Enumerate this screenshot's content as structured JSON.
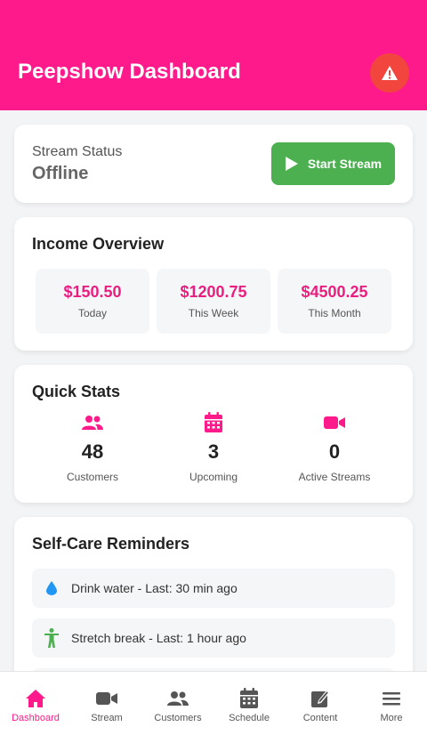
{
  "header": {
    "title": "Peepshow Dashboard",
    "alert_icon": "warning-icon"
  },
  "stream_status": {
    "label": "Stream Status",
    "value": "Offline",
    "button_label": "Start Stream"
  },
  "income": {
    "title": "Income Overview",
    "items": [
      {
        "value": "$150.50",
        "label": "Today"
      },
      {
        "value": "$1200.75",
        "label": "This Week"
      },
      {
        "value": "$4500.25",
        "label": "This Month"
      }
    ]
  },
  "quick_stats": {
    "title": "Quick Stats",
    "items": [
      {
        "icon": "users-icon",
        "value": "48",
        "label": "Customers"
      },
      {
        "icon": "calendar-icon",
        "value": "3",
        "label": "Upcoming"
      },
      {
        "icon": "video-icon",
        "value": "0",
        "label": "Active Streams"
      }
    ]
  },
  "self_care": {
    "title": "Self-Care Reminders",
    "items": [
      {
        "icon": "water-drop-icon",
        "text": "Drink water - Last: 30 min ago"
      },
      {
        "icon": "stretch-icon",
        "text": "Stretch break - Last: 1 hour ago"
      }
    ]
  },
  "nav": {
    "items": [
      {
        "icon": "home-icon",
        "label": "Dashboard",
        "active": true
      },
      {
        "icon": "video-icon",
        "label": "Stream"
      },
      {
        "icon": "users-icon",
        "label": "Customers"
      },
      {
        "icon": "calendar-icon",
        "label": "Schedule"
      },
      {
        "icon": "edit-icon",
        "label": "Content"
      },
      {
        "icon": "menu-icon",
        "label": "More"
      }
    ]
  },
  "colors": {
    "brand": "#ff1a8c",
    "alert": "#f2453d",
    "start_button": "#4caf50",
    "income_value": "#e91e7f"
  }
}
